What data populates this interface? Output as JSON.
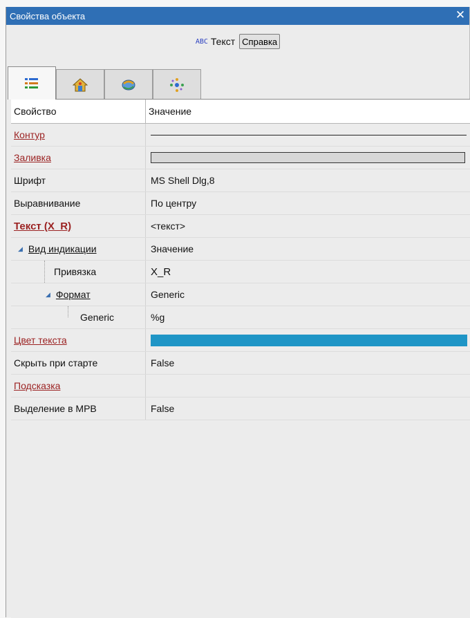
{
  "window": {
    "title": "Свойства объекта"
  },
  "typebar": {
    "type_icon": "ABC",
    "type_label": "Текст",
    "help_label": "Справка"
  },
  "tabs": [
    {
      "icon": "properties-list-icon",
      "active": true
    },
    {
      "icon": "house-icon",
      "active": false
    },
    {
      "icon": "scripts-icon",
      "active": false
    },
    {
      "icon": "animation-icon",
      "active": false
    }
  ],
  "grid": {
    "headers": {
      "property": "Свойство",
      "value": "Значение"
    },
    "rows": [
      {
        "name": "Контур",
        "kind": "line"
      },
      {
        "name": "Заливка",
        "kind": "fill"
      },
      {
        "name": "Шрифт",
        "value": "MS Shell Dlg,8"
      },
      {
        "name": "Выравнивание",
        "value": "По центру"
      },
      {
        "name": "Текст (X_R)",
        "value": "<текст>"
      },
      {
        "name": "Вид индикации",
        "value": "Значение"
      },
      {
        "name": "Привязка",
        "value": "X_R"
      },
      {
        "name": "Формат",
        "value": "Generic"
      },
      {
        "name": "Generic",
        "value": "%g"
      },
      {
        "name": "Цвет текста",
        "kind": "color"
      },
      {
        "name": "Скрыть при старте",
        "value": "False"
      },
      {
        "name": "Подсказка",
        "value": ""
      },
      {
        "name": "Выделение в MPB",
        "value": "False"
      }
    ]
  },
  "colors": {
    "title_bar": "#2f6fb5",
    "text_color_swatch": "#1f95c6",
    "link": "#9b2222"
  }
}
